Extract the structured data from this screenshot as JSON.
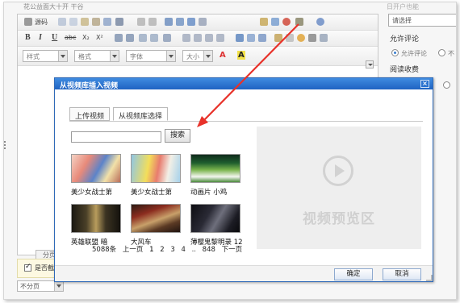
{
  "background": {
    "top_faded": "花公益面大十开 干谷",
    "paging_tab": "分页符",
    "checkbox_label": "是否截取",
    "paging_select": "不分页",
    "toolbar": {
      "source": "源码",
      "style": "样式",
      "format": "格式",
      "font": "字体",
      "size": "大小",
      "bold": "B",
      "italic": "I",
      "underline": "U",
      "strike": "abc",
      "sub": "X₂",
      "sup": "X²",
      "font_color": "A",
      "bg_color": "A"
    }
  },
  "right_panel": {
    "header": "日开户也能",
    "select": "请选择",
    "allow_comment": "允许评论",
    "radio_allow": "允许评论",
    "radio_deny": "不",
    "read_fee": "阅读收费"
  },
  "dialog": {
    "title": "从视频库插入视频",
    "close": "×",
    "tabs": [
      "上传视频",
      "从视频库选择"
    ],
    "search_placeholder": "",
    "search_button": "搜索",
    "videos": [
      {
        "label": "美少女战士第",
        "palette": "anime1"
      },
      {
        "label": "美少女战士第",
        "palette": "anime2"
      },
      {
        "label": "动画片 小鸡",
        "palette": "cartoon"
      },
      {
        "label": "英雄联盟 暗",
        "palette": "dark1"
      },
      {
        "label": "大风车",
        "palette": "stage"
      },
      {
        "label": "薄樱鬼黎明录 12",
        "palette": "dark2"
      }
    ],
    "pager": {
      "total": "5088条",
      "prev": "上一页",
      "pages": [
        "1",
        "2",
        "3",
        "4",
        "..",
        "848"
      ],
      "next": "下一页"
    },
    "preview_text": "视频预览区",
    "confirm": "确定",
    "cancel": "取消"
  }
}
